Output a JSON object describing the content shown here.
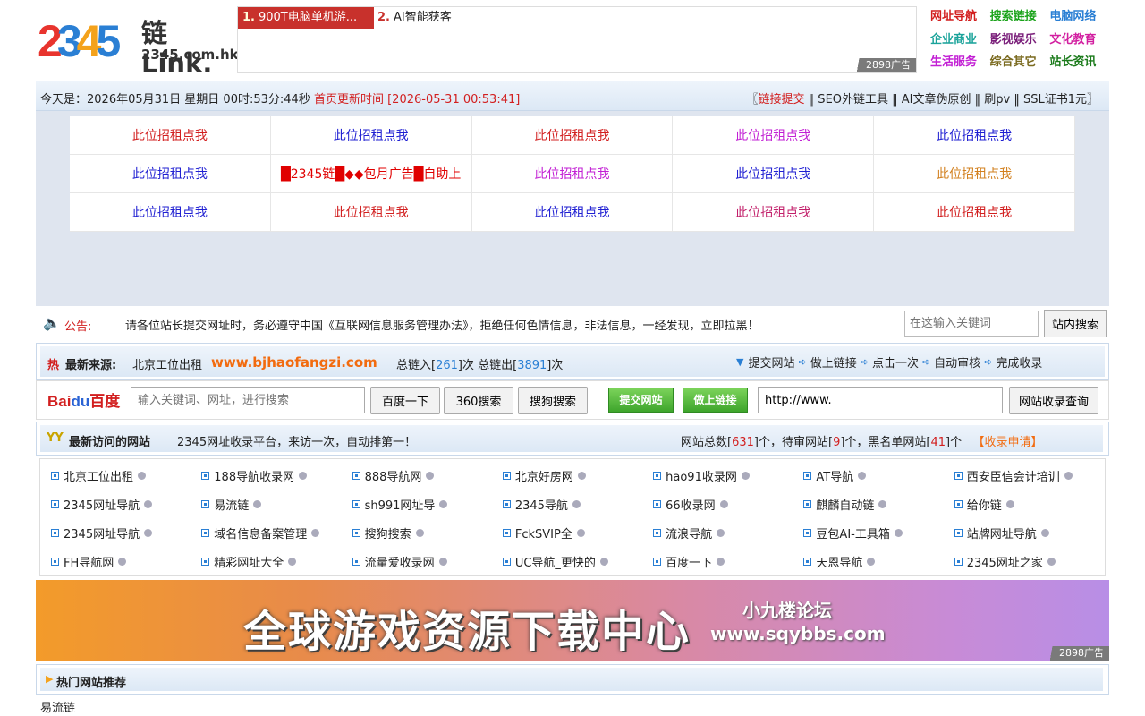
{
  "logo": {
    "digit1": "2",
    "digit2": "3",
    "digit3": "4",
    "digit4": "5",
    "link_text": "链Link.",
    "domain": "2345.com.hk"
  },
  "top_ad": {
    "item1_num": "1.",
    "item1_text": "900T电脑单机游...",
    "item2_num": "2.",
    "item2_text": "AI智能获客",
    "tag": "2898广告"
  },
  "category_nav": [
    {
      "label": "网址导航",
      "color": "#d21f1f"
    },
    {
      "label": "搜索链接",
      "color": "#1aa31a"
    },
    {
      "label": "电脑网络",
      "color": "#2a7fd4"
    },
    {
      "label": "企业商业",
      "color": "#1aa39a"
    },
    {
      "label": "影视娱乐",
      "color": "#7a1f7a"
    },
    {
      "label": "文化教育",
      "color": "#d21fa0"
    },
    {
      "label": "生活服务",
      "color": "#c21fd4"
    },
    {
      "label": "综合其它",
      "color": "#7a6a1f"
    },
    {
      "label": "站长资讯",
      "color": "#1a7a1a"
    }
  ],
  "date_bar": {
    "today": "今天是：2026年05月31日 星期日 00时:53分:44秒",
    "update": "首页更新时间 [2026-05-31 00:53:41]",
    "links_prefix": "〖",
    "submit": "链接提交",
    "sep1": " ‖ SEO外链工具 ‖ AI文章伪原创 ‖ 刷pv ‖ SSL证书1元〗"
  },
  "ad_grid": [
    {
      "text": "此位招租点我",
      "color": "#d21f1f"
    },
    {
      "text": "此位招租点我",
      "color": "#1f1fd2"
    },
    {
      "text": "此位招租点我",
      "color": "#d21f1f"
    },
    {
      "text": "此位招租点我",
      "color": "#c21fd4"
    },
    {
      "text": "此位招租点我",
      "color": "#1f1fd2"
    },
    {
      "text": "此位招租点我",
      "color": "#1f1fd2"
    },
    {
      "text": "█2345链█◆◆包月广告█自助上",
      "color": "#e00000"
    },
    {
      "text": "此位招租点我",
      "color": "#c21fd4"
    },
    {
      "text": "此位招租点我",
      "color": "#1f1fd2"
    },
    {
      "text": "此位招租点我",
      "color": "#d2801f"
    },
    {
      "text": "此位招租点我",
      "color": "#1f1fd2"
    },
    {
      "text": "此位招租点我",
      "color": "#d21f1f"
    },
    {
      "text": "此位招租点我",
      "color": "#1f1fd2"
    },
    {
      "text": "此位招租点我",
      "color": "#c21f6a"
    },
    {
      "text": "此位招租点我",
      "color": "#d21f1f"
    }
  ],
  "notice": {
    "icon": "🔈",
    "label": "公告:",
    "text": "请各位站长提交网址时，务必遵守中国《互联网信息服务管理办法》，拒绝任何色情信息，非法信息，一经发现，立即拉黑！",
    "search_placeholder": "在这输入关键词",
    "search_button": "站内搜索"
  },
  "source_bar": {
    "fire": "热",
    "label": "最新来源:",
    "name": "北京工位出租",
    "url": "www.bjhaofangzi.com",
    "in_prefix": "总链入[",
    "in_value": "261",
    "in_mid": "]次 总链出[",
    "out_value": "3891",
    "out_suffix": "]次",
    "steps": [
      "提交网站",
      "做上链接",
      "点击一次",
      "自动审核",
      "完成收录"
    ]
  },
  "search_bar": {
    "baidu_bai": "Bai",
    "baidu_du": "du",
    "baidu_cn": "百度",
    "placeholder": "输入关键词、网址，进行搜索",
    "btn_baidu": "百度一下",
    "btn_360": "360搜索",
    "btn_sogou": "搜狗搜索",
    "btn_submit": "提交网站",
    "btn_link": "做上链接",
    "url_value": "http://www.",
    "btn_check": "网站收录查询"
  },
  "recent_bar": {
    "icon": "YY",
    "label": "最新访问的网站",
    "text": "2345网址收录平台，来访一次，自动排第一！",
    "total_prefix": "网站总数[",
    "total": "631",
    "pending_prefix": "]个，待审网站[",
    "pending": "9",
    "black_prefix": "]个，黑名单网站[",
    "black": "41",
    "black_suffix": "]个",
    "apply": "【收录申请】"
  },
  "site_list": [
    "北京工位出租",
    "188导航收录网",
    "888导航网",
    "北京好房网",
    "hao91收录网",
    "AT导航",
    "西安臣信会计培训",
    "2345网址导航",
    "易流链",
    "sh991网址导",
    "2345导航",
    "66收录网",
    "麒麟自动链",
    "给你链",
    "2345网址导航",
    "域名信息备案管理",
    "搜狗搜索",
    "FckSVIP全",
    "流浪导航",
    "豆包AI-工具箱",
    "站牌网址导航",
    "FH导航网",
    "精彩网址大全",
    "流量爱收录网",
    "UC导航_更快的",
    "百度一下",
    "天恩导航",
    "2345网址之家"
  ],
  "banner": {
    "title": "全球游戏资源下载中心",
    "sub1": "小九楼论坛",
    "sub2": "www.sqybbs.com",
    "tag": "2898广告"
  },
  "hot": {
    "label": "热门网站推荐",
    "first": "易流链"
  }
}
